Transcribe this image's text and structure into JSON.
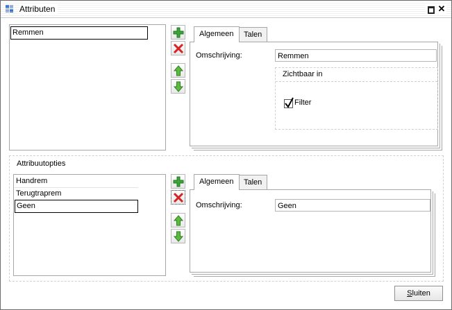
{
  "window": {
    "title": "Attributen"
  },
  "attributes": {
    "items": [
      "Remmen"
    ],
    "tabs": [
      {
        "label": "Algemeen"
      },
      {
        "label": "Talen"
      }
    ],
    "description_label": "Omschrijving:",
    "description_value": "Remmen",
    "visible_group_title": "Zichtbaar in",
    "filter_label": "Filter",
    "filter_checked": true
  },
  "options": {
    "section_title": "Attribuutopties",
    "items": [
      "Handrem",
      "Terugtraprem",
      "Geen"
    ],
    "tabs": [
      {
        "label": "Algemeen"
      },
      {
        "label": "Talen"
      }
    ],
    "description_label": "Omschrijving:",
    "description_value": "Geen"
  },
  "footer": {
    "close_label_underlined": "S",
    "close_label_rest": "luiten"
  },
  "colors": {
    "add": "#3ea33a",
    "delete": "#d62424",
    "arrow": "#3ea33a"
  },
  "icons": [
    "app-grid-icon",
    "maximize-icon",
    "close-icon",
    "plus-icon",
    "delete-x-icon",
    "arrow-up-icon",
    "arrow-down-icon",
    "checkmark-icon"
  ]
}
